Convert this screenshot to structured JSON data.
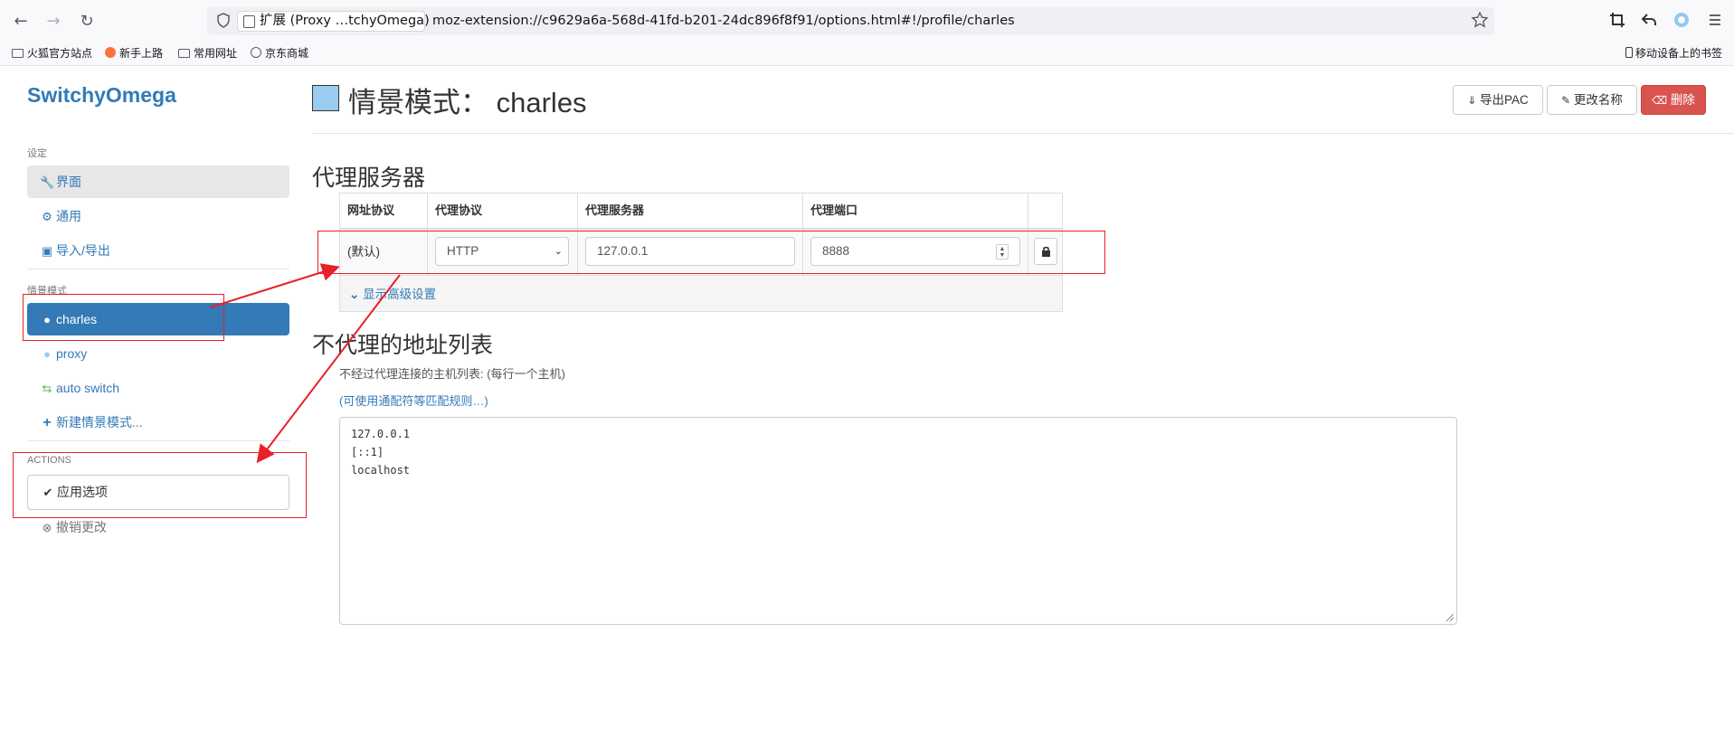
{
  "browser": {
    "tab_label": "扩展 (Proxy …tchyOmega)",
    "url": "moz-extension://c9629a6a-568d-41fd-b201-24dc896f8f91/options.html#!/profile/charles",
    "bookmarks": [
      "火狐官方站点",
      "新手上路",
      "常用网址",
      "京东商城"
    ],
    "mobile_bookmarks": "移动设备上的书签"
  },
  "sidebar": {
    "brand": "SwitchyOmega",
    "settings_header": "设定",
    "settings_items": [
      {
        "label": "界面",
        "icon": "wrench-icon"
      },
      {
        "label": "通用",
        "icon": "gear-icon"
      },
      {
        "label": "导入/导出",
        "icon": "floppy-icon"
      }
    ],
    "profiles_header": "情景模式",
    "profile_items": [
      {
        "label": "charles",
        "icon": "globe-icon"
      },
      {
        "label": "proxy",
        "icon": "globe-icon"
      },
      {
        "label": "auto switch",
        "icon": "retweet-icon"
      },
      {
        "label": "新建情景模式...",
        "icon": "plus-icon"
      }
    ],
    "actions_header": "ACTIONS",
    "apply_label": "应用选项",
    "discard_label": "撤销更改"
  },
  "header": {
    "title_prefix": "情景模式：",
    "profile_name": "charles",
    "swatch_color": "#99ccee",
    "export_pac_label": "导出PAC",
    "rename_label": "更改名称",
    "delete_label": "删除"
  },
  "proxy_section": {
    "heading": "代理服务器",
    "columns": [
      "网址协议",
      "代理协议",
      "代理服务器",
      "代理端口"
    ],
    "row": {
      "scheme": "(默认)",
      "protocol": "HTTP",
      "server": "127.0.0.1",
      "port": "8888"
    },
    "advanced_toggle": "显示高级设置"
  },
  "bypass_section": {
    "heading": "不代理的地址列表",
    "help_text": "不经过代理连接的主机列表: (每行一个主机)",
    "wildcard_link": "(可使用通配符等匹配规则…)",
    "lines": [
      "127.0.0.1",
      "[::1]",
      "localhost"
    ]
  },
  "colors": {
    "accent": "#337ab7",
    "active_item_bg": "#337ab7",
    "danger": "#d9534f",
    "annotation_red": "#e8202a"
  }
}
